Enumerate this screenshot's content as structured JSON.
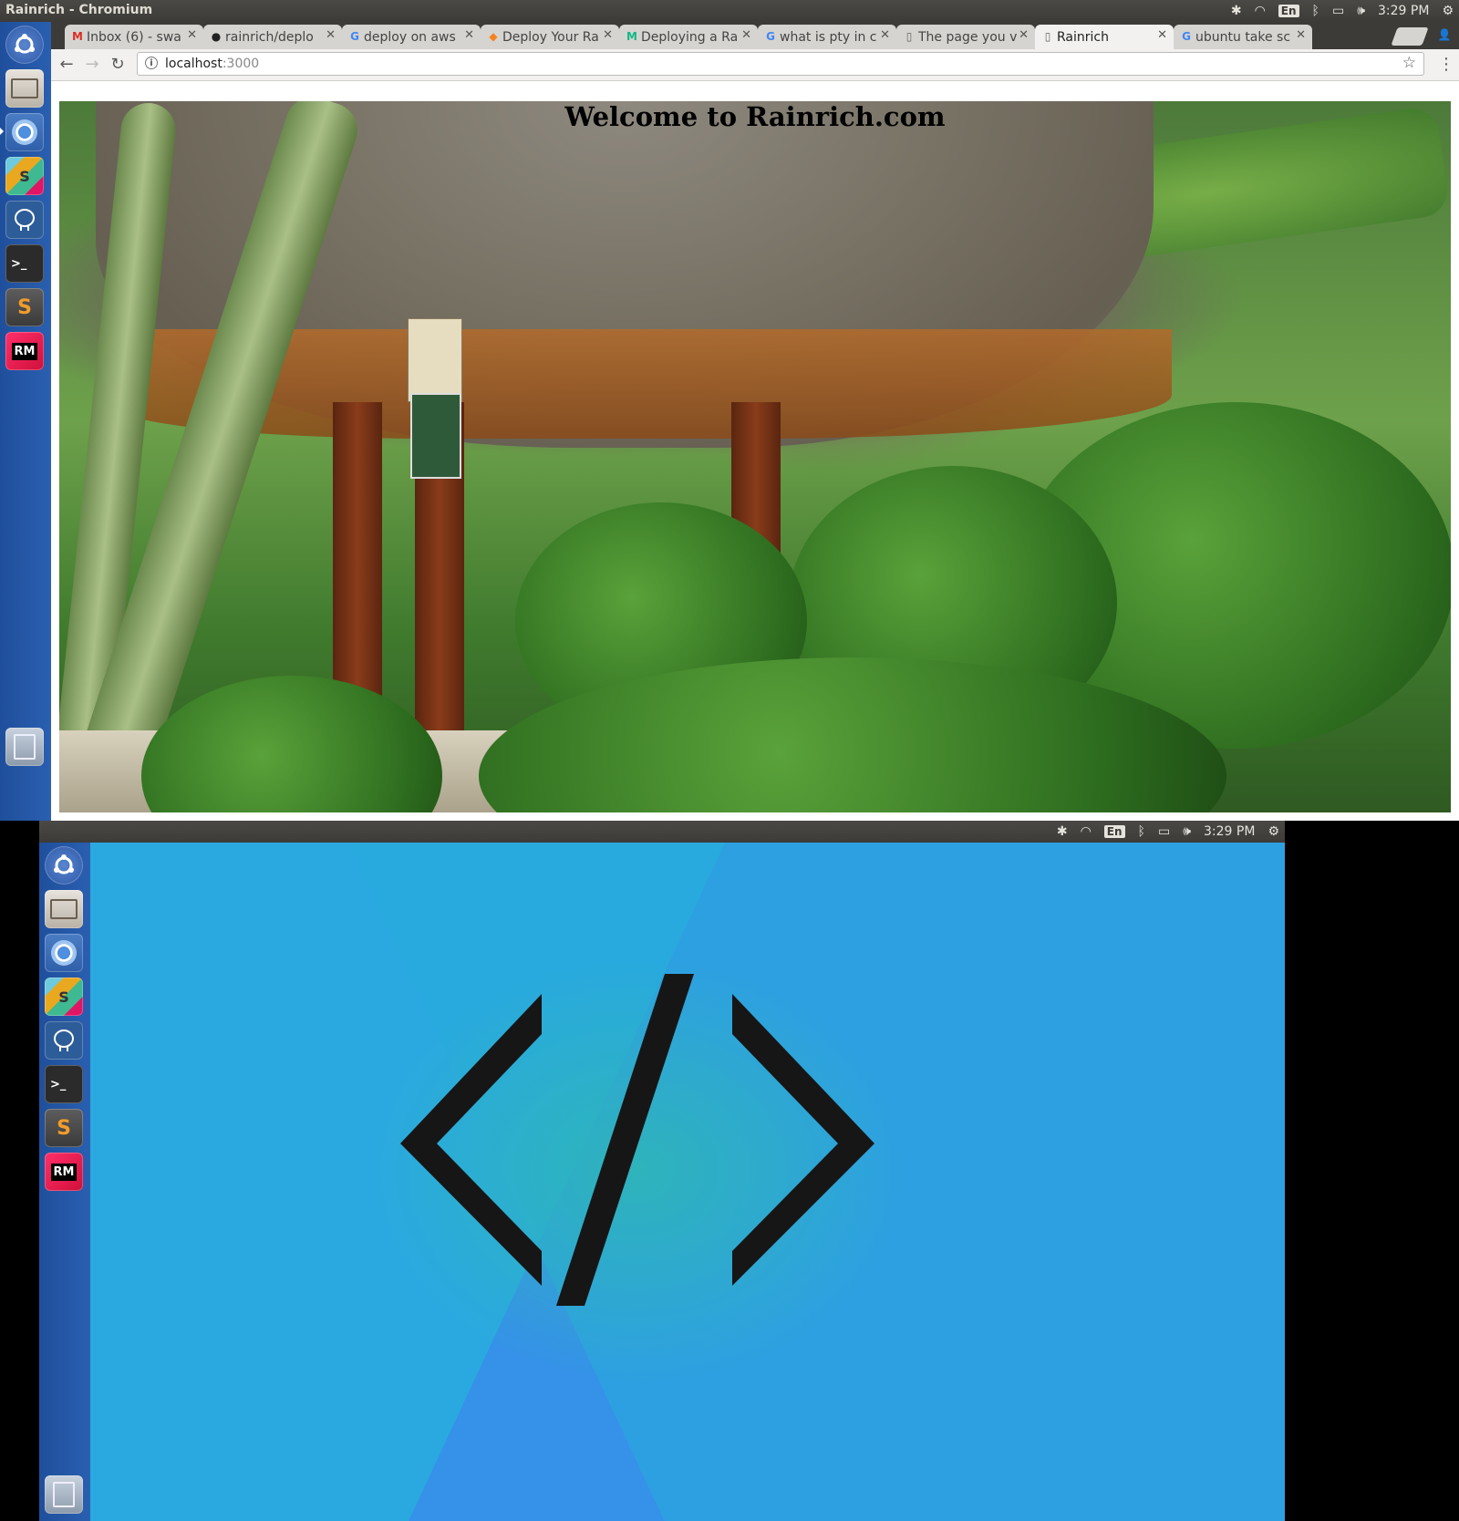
{
  "window": {
    "title": "Rainrich - Chromium"
  },
  "tray": {
    "lang": "En",
    "time": "3:29 PM"
  },
  "launcher": [
    {
      "name": "ubuntu-dash-icon",
      "label": ""
    },
    {
      "name": "files-icon",
      "label": ""
    },
    {
      "name": "chromium-icon",
      "label": ""
    },
    {
      "name": "slack-icon",
      "label": "S"
    },
    {
      "name": "pgadmin-elephant-icon",
      "label": ""
    },
    {
      "name": "terminal-icon",
      "label": ">_"
    },
    {
      "name": "sublime-text-icon",
      "label": "S"
    },
    {
      "name": "rubymine-icon",
      "label": "RM"
    }
  ],
  "tabs": [
    {
      "label": "Inbox (6) - swa",
      "favicon": "M",
      "favicon_color": "#d93025"
    },
    {
      "label": "rainrich/deplo",
      "favicon": "●",
      "favicon_color": "#222222"
    },
    {
      "label": "deploy on aws",
      "favicon": "G",
      "favicon_color": "#4285f4"
    },
    {
      "label": "Deploy Your Ra",
      "favicon": "◆",
      "favicon_color": "#f58220"
    },
    {
      "label": "Deploying a Ra",
      "favicon": "M",
      "favicon_color": "#12b886"
    },
    {
      "label": "what is pty in c",
      "favicon": "G",
      "favicon_color": "#4285f4"
    },
    {
      "label": "The page you v",
      "favicon": "▯",
      "favicon_color": "#666666"
    },
    {
      "label": "Rainrich",
      "favicon": "▯",
      "favicon_color": "#666666"
    },
    {
      "label": "ubuntu take sc",
      "favicon": "G",
      "favicon_color": "#4285f4"
    }
  ],
  "omnibox": {
    "host": "localhost",
    "port": ":3000"
  },
  "page": {
    "heading": "Welcome to Rainrich.com"
  },
  "desktop": {
    "tray_time": "3:29 PM",
    "tray_lang": "En"
  }
}
